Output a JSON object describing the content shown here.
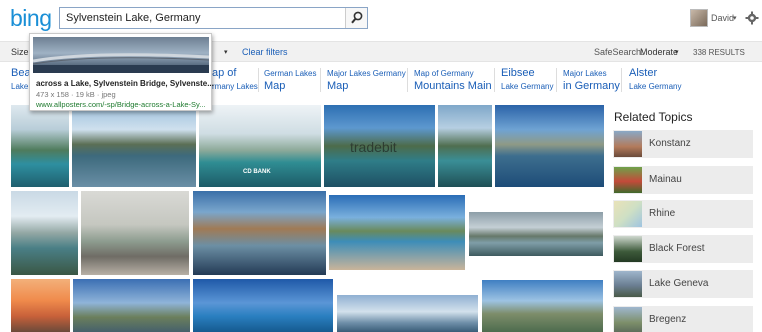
{
  "header": {
    "logo": "bing",
    "search_value": "Sylvenstein Lake, Germany",
    "user_name": "David",
    "user_caret": "▾"
  },
  "filters": {
    "size": "Size",
    "style": "le",
    "style_caret": "▾",
    "clear": "Clear filters",
    "safesearch_label": "SafeSearch:",
    "safesearch_value": "Moderate",
    "safesearch_caret": "▾",
    "result_count": "338 RESULTS"
  },
  "related_searches": [
    {
      "line1": "Bea",
      "line2": "Lake"
    },
    {
      "line1": "ap of",
      "line2": "rmany Lakes"
    },
    {
      "line1": "German Lakes",
      "line2": "Map"
    },
    {
      "line1": "Major Lakes Germany",
      "line2": "Map"
    },
    {
      "line1": "Map of Germany",
      "line2": "Mountains Main"
    },
    {
      "line1": "Eibsee",
      "line2": "Lake Germany"
    },
    {
      "line1": "Major Lakes",
      "line2": "in Germany"
    },
    {
      "line1": "Alster",
      "line2": "Lake Germany"
    }
  ],
  "hover_card": {
    "title": "across a Lake, Sylvenstein Bridge, Sylvenste...",
    "meta": "473 x 158 · 19 kB · jpeg",
    "url": "www.allposters.com/-sp/Bridge-across-a-Lake-Sy..."
  },
  "image_overlays": {
    "cd_bank": "CD BANK",
    "tradebit": "tradebit"
  },
  "related_topics": {
    "title": "Related Topics",
    "items": [
      {
        "label": "Konstanz"
      },
      {
        "label": "Mainau"
      },
      {
        "label": "Rhine"
      },
      {
        "label": "Black Forest"
      },
      {
        "label": "Lake Geneva"
      },
      {
        "label": "Bregenz"
      }
    ]
  },
  "colors": {
    "brand": "#1a8fd6",
    "link": "#1a5eb7",
    "url_green": "#1e7a2e"
  }
}
